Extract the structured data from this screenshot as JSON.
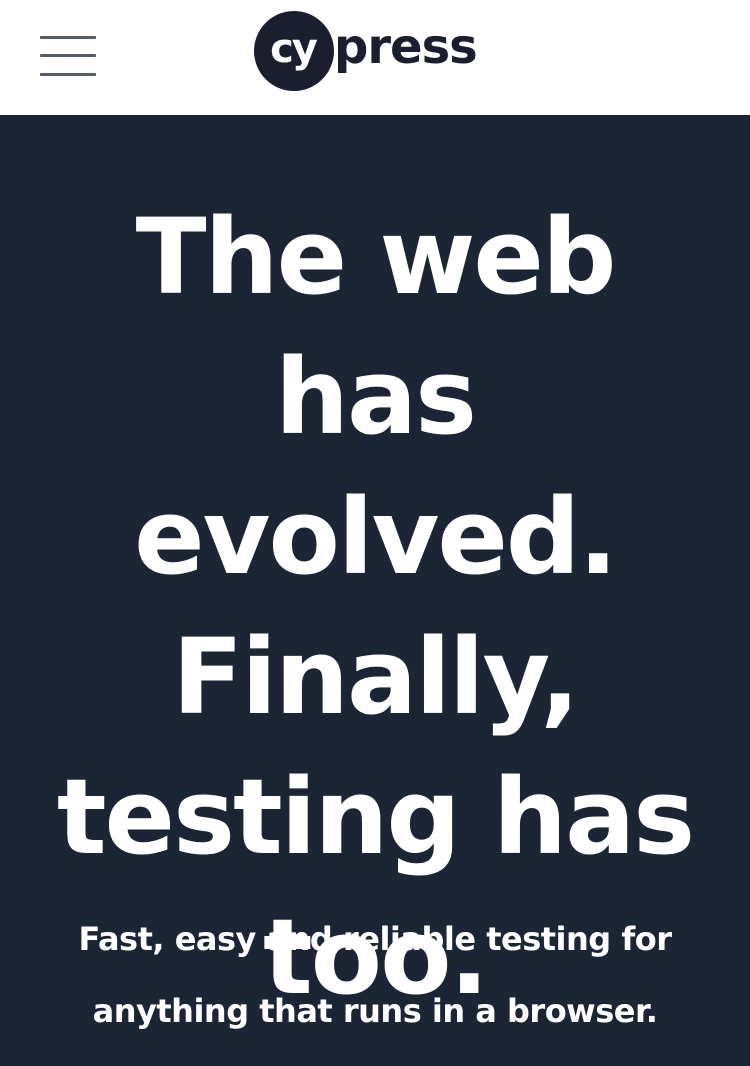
{
  "header": {
    "menu_icon": "hamburger-menu-icon",
    "logo": {
      "badge_text": "cy",
      "word_text": "press"
    }
  },
  "hero": {
    "title": "The web has evolved. Finally, testing has too.",
    "subtitle": "Fast, easy and reliable testing for anything that runs in a browser."
  },
  "colors": {
    "header_background": "#ffffff",
    "hero_background": "#1b2535",
    "logo_dark": "#1b1e2e",
    "text_light": "#ffffff",
    "menu_icon": "#555c66"
  }
}
